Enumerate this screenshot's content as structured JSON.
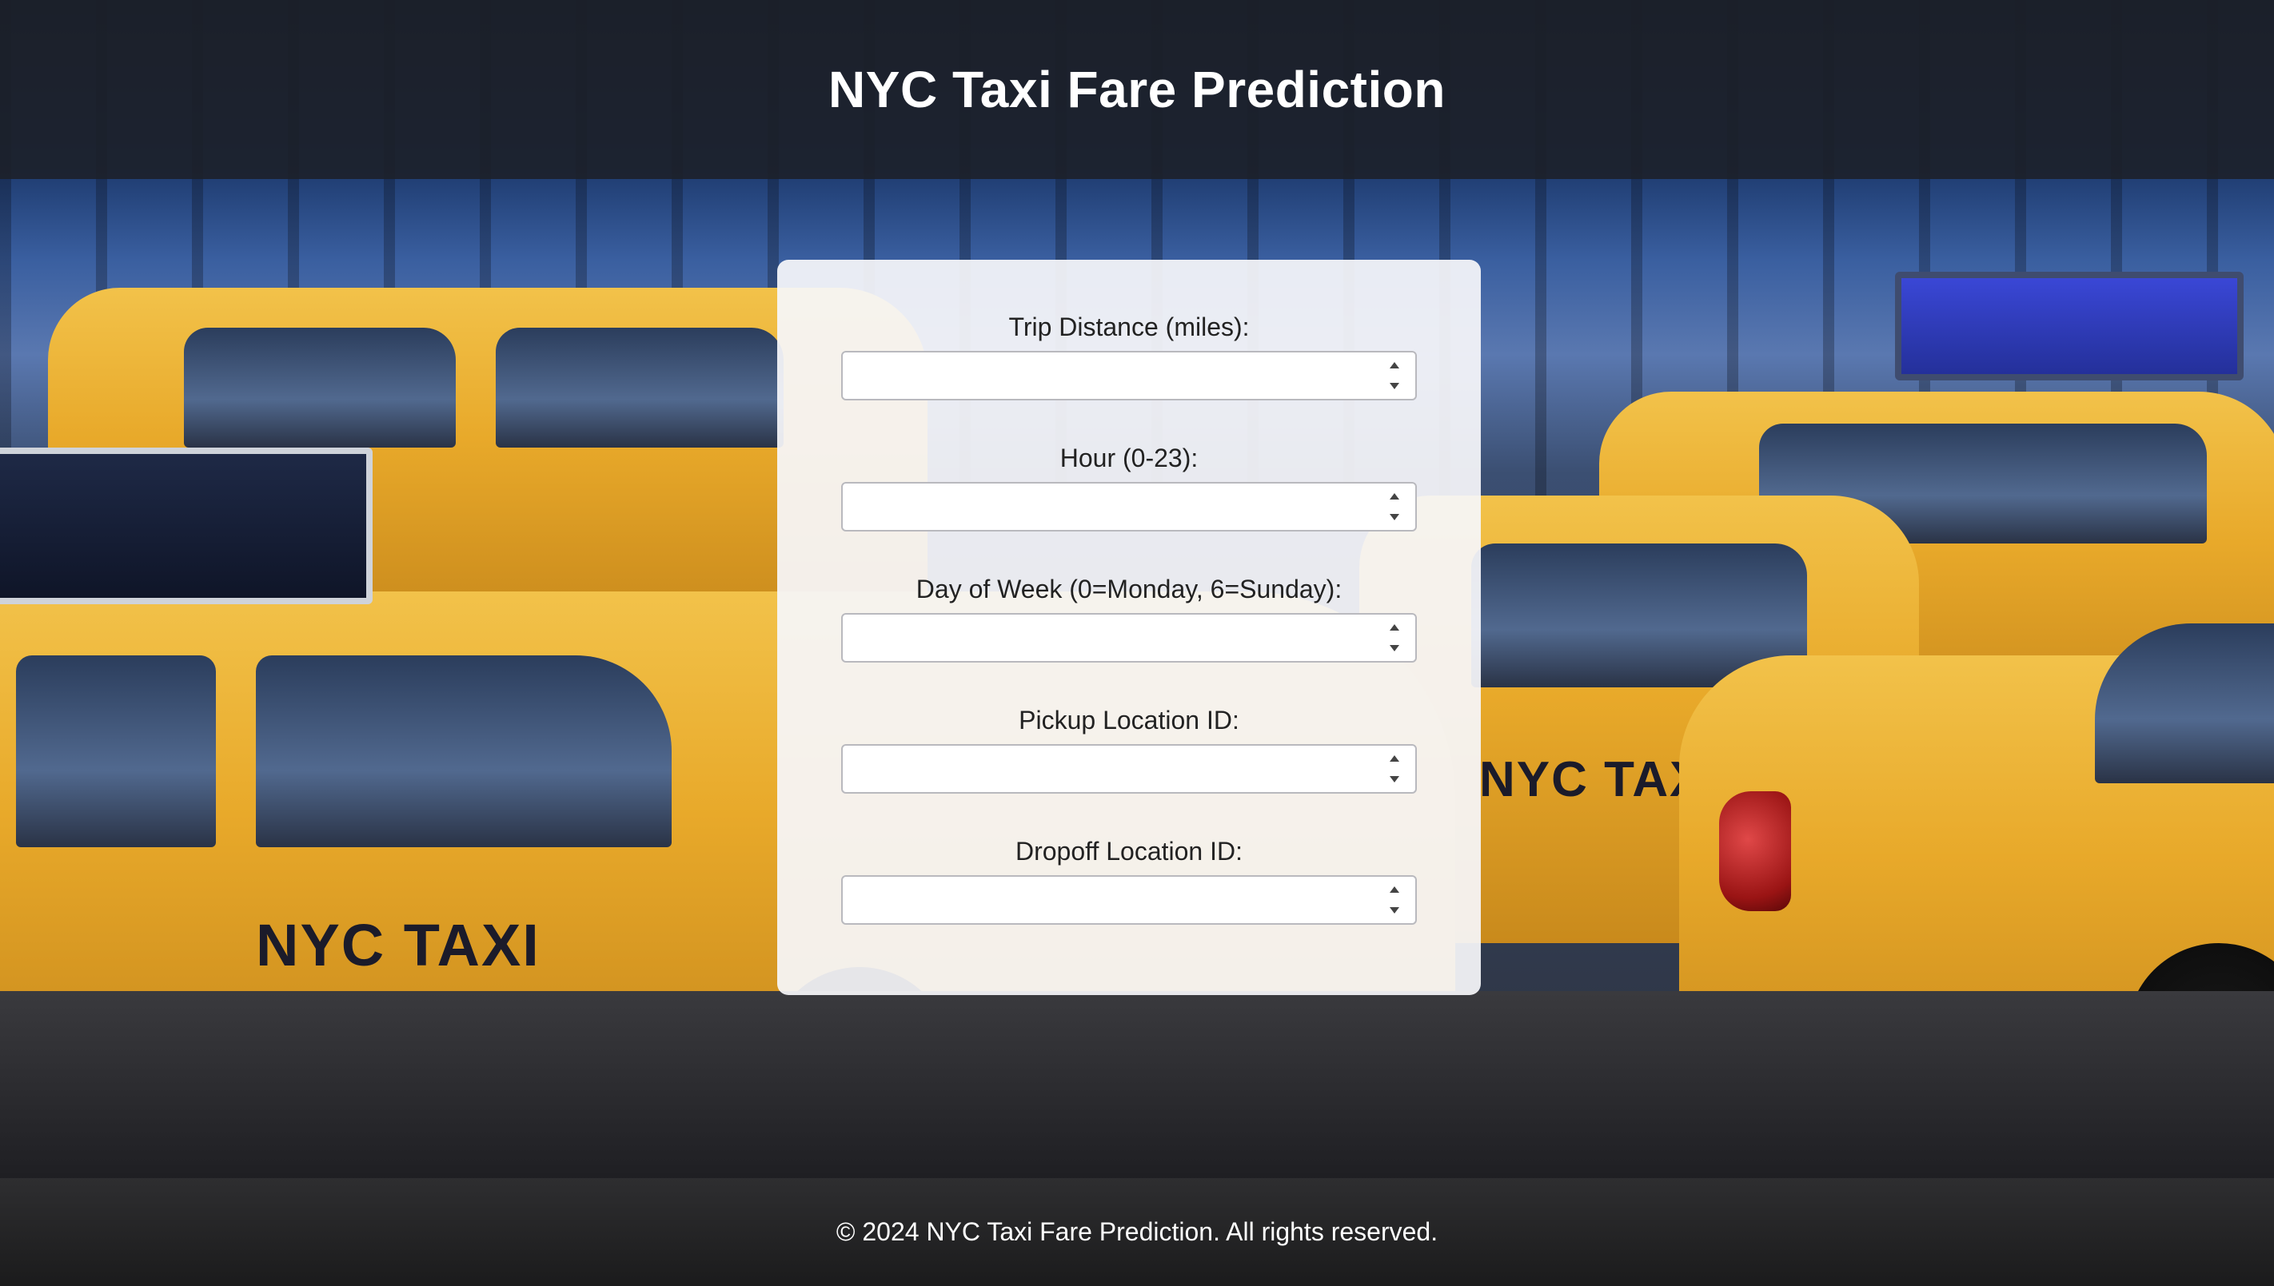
{
  "header": {
    "title": "NYC Taxi Fare Prediction"
  },
  "form": {
    "fields": [
      {
        "label": "Trip Distance (miles):",
        "value": ""
      },
      {
        "label": "Hour (0-23):",
        "value": ""
      },
      {
        "label": "Day of Week (0=Monday, 6=Sunday):",
        "value": ""
      },
      {
        "label": "Pickup Location ID:",
        "value": ""
      },
      {
        "label": "Dropoff Location ID:",
        "value": ""
      }
    ]
  },
  "footer": {
    "text": "© 2024 NYC Taxi Fare Prediction. All rights reserved."
  },
  "background": {
    "logo_text": "NYC TAXI",
    "colors": {
      "taxi_yellow": "#e8a92a",
      "header_bg": "#1c2028",
      "footer_bg": "#1b1b1c",
      "card_bg": "#f6f6fa"
    }
  }
}
